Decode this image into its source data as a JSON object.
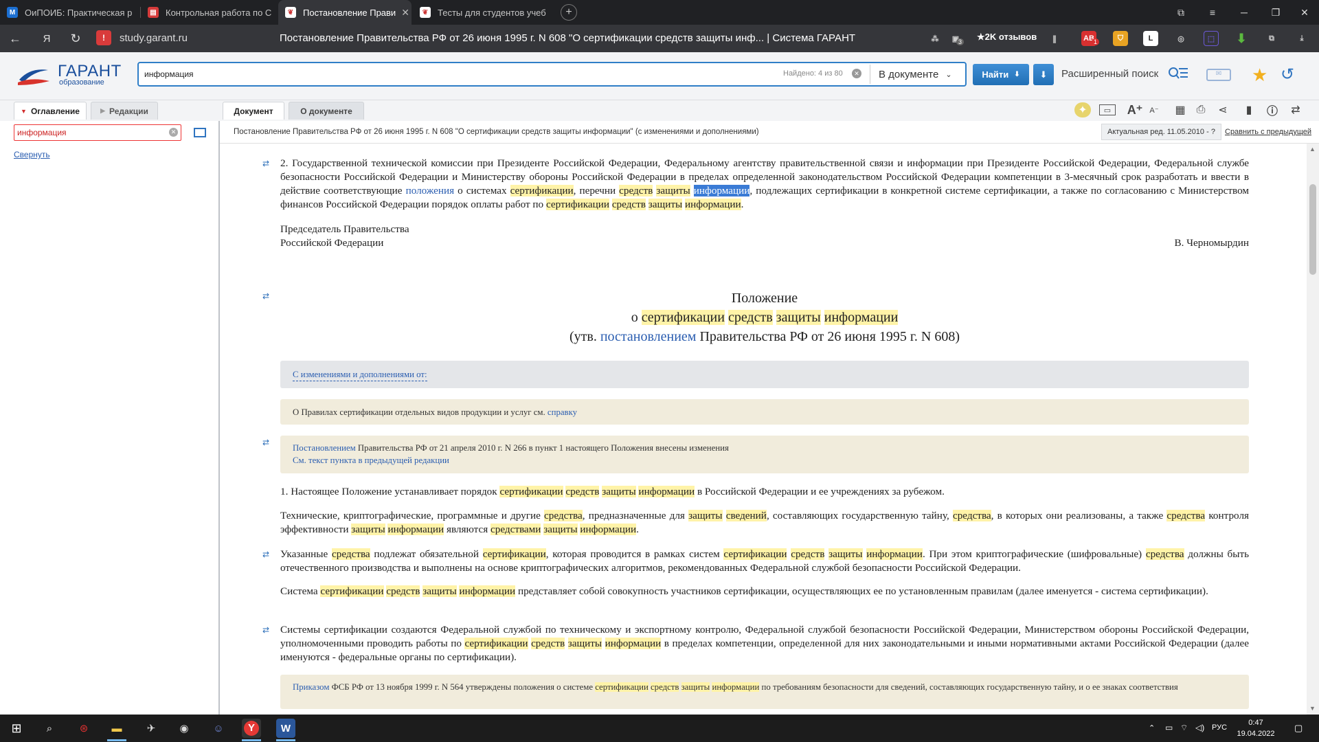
{
  "browser": {
    "tabs": [
      {
        "title": "ОиПОИБ: Практическая р",
        "icon": "moodle-icon",
        "color": "#1c6fd1",
        "active": false
      },
      {
        "title": "Контрольная работа по С",
        "icon": "pdf-icon",
        "color": "#d63b3b",
        "active": false
      },
      {
        "title": "Постановление Прави",
        "icon": "garant-icon",
        "color": "#2a5db0",
        "active": true
      },
      {
        "title": "Тесты для студентов учеб",
        "icon": "garant-icon",
        "color": "#2a5db0",
        "active": false
      }
    ],
    "new_tab": "+",
    "address": "study.garant.ru",
    "page_title": "Постановление Правительства РФ от 26 июня 1995 г. N 608 \"О сертификации средств защиты инф... | Система ГАРАНТ",
    "reviews": "★2K отзывов",
    "ext_badge": "3",
    "ext_ab": "AB",
    "ext_ab_badge": "1",
    "ext_l": "L"
  },
  "garant": {
    "logo": "ГАРАНТ",
    "logo_sub": "образование",
    "search_value": "информация",
    "found": "Найдено: 4 из 80",
    "scope": "В документе",
    "find_button": "Найти",
    "advanced": "Расширенный поиск"
  },
  "left_panel": {
    "tabs": [
      "Оглавление",
      "Редакции"
    ],
    "search_value": "информация",
    "collapse": "Свернуть"
  },
  "doc_tabs": [
    "Документ",
    "О документе"
  ],
  "doc_info": {
    "title": "Постановление Правительства РФ от 26 июня 1995 г. N 608 \"О сертификации средств защиты информации\" (с изменениями и дополнениями)",
    "actual": "Актуальная ред. 11.05.2010 - ?",
    "compare": "Сравнить с предыдущей"
  },
  "document": {
    "p1": [
      "2. Государственной технической комиссии при Президенте Российской Федерации, Федеральному агентству правительственной связи и информации при Президенте Российской Федерации, Федеральной службе безопасности Российской Федерации и Министерству обороны Российской Федерации в пределах определенной законодательством Российской Федерации компетенции в 3-месячный срок разработать и ввести в действие соответствующие ",
      "положения",
      " о системах ",
      "сертификации",
      ", перечни ",
      "средств",
      " ",
      "защиты",
      " ",
      "информации",
      ", подлежащих сертификации в конкретной системе сертификации, а также по согласованию с Министерством финансов Российской Федерации порядок оплаты работ по ",
      "сертификации",
      " ",
      "средств",
      " ",
      "защиты",
      " ",
      "информации",
      "."
    ],
    "sign_1": "Председатель Правительства",
    "sign_2": "Российской Федерации",
    "signer": "В. Черномырдин",
    "heading_1": "Положение",
    "heading_2": [
      "о ",
      "сертификации",
      " ",
      "средств",
      " ",
      "защиты",
      " ",
      "информации"
    ],
    "heading_3": [
      "(утв. ",
      "постановлением",
      " Правительства РФ от 26 июня 1995 г. N 608)"
    ],
    "changes_link": "С изменениями и дополнениями от:",
    "note_1": [
      "О Правилах сертификации отдельных видов продукции и услуг см. ",
      "справку"
    ],
    "note_2_line1": [
      "Постановлением",
      " Правительства РФ от 21 апреля 2010 г. N 266 в пункт 1 настоящего Положения внесены изменения"
    ],
    "note_2_line2": "См. текст пункта в предыдущей редакции",
    "p2": [
      "1. Настоящее Положение устанавливает порядок ",
      "сертификации",
      " ",
      "средств",
      " ",
      "защиты",
      " ",
      "информации",
      " в Российской Федерации и ее учреждениях за рубежом."
    ],
    "p3": [
      "Технические, криптографические, программные и другие ",
      "средства",
      ", предназначенные для ",
      "защиты",
      " ",
      "сведений",
      ", составляющих государственную тайну, ",
      "средства",
      ", в которых они реализованы, а также ",
      "средства",
      " контроля эффективности ",
      "защиты",
      " ",
      "информации",
      " являются ",
      "средствами",
      " ",
      "защиты",
      " ",
      "информации",
      "."
    ],
    "p4": [
      "Указанные ",
      "средства",
      " подлежат обязательной ",
      "сертификации",
      ", которая проводится в рамках систем ",
      "сертификации",
      " ",
      "средств",
      " ",
      "защиты",
      " ",
      "информации",
      ". При этом криптографические (шифровальные) ",
      "средства",
      " должны быть отечественного производства и выполнены на основе криптографических алгоритмов, рекомендованных Федеральной службой безопасности Российской Федерации."
    ],
    "p5": [
      "Система ",
      "сертификации",
      " ",
      "средств",
      " ",
      "защиты",
      " ",
      "информации",
      " представляет собой совокупность участников сертификации, осуществляющих ее по установленным правилам (далее именуется - система сертификации)."
    ],
    "p6": [
      "Системы сертификации создаются Федеральной службой по техническому и экспортному контролю, Федеральной службой безопасности Российской Федерации, Министерством обороны Российской Федерации, уполномоченными проводить работы по ",
      "сертификации",
      " ",
      "средств",
      " ",
      "защиты",
      " ",
      "информации",
      " в пределах компетенции, определенной для них законодательными и иными нормативными актами Российской Федерации (далее именуются - федеральные органы по сертификации)."
    ],
    "note_3": [
      "Приказом",
      " ФСБ РФ от 13 ноября 1999 г. N 564 утверждены положения о системе ",
      "сертификации",
      " ",
      "средств",
      " ",
      "защиты",
      " ",
      "информации",
      " по требованиям безопасности для сведений, составляющих государственную тайну, и о ее знаках соответствия"
    ]
  },
  "taskbar": {
    "lang": "РУС",
    "time": "0:47",
    "date": "19.04.2022"
  },
  "colors": {
    "highlight": "#fff3a8",
    "selection": "#3a7bd5",
    "link": "#2a5db0",
    "accent": "#2f7ec7"
  }
}
